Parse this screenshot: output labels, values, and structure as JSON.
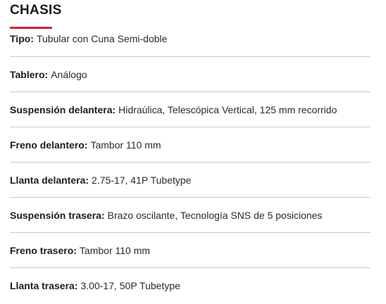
{
  "section": {
    "title": "CHASIS",
    "accent_color": "#d0242b"
  },
  "specs": [
    {
      "label": "Tipo",
      "sep": " :",
      "value": "Tubular con Cuna Semi-doble"
    },
    {
      "label": "Tablero",
      "sep": " :",
      "value": "Análogo"
    },
    {
      "label": "Suspensión delantera",
      "sep": " :",
      "value": "Hidraúlica, Telescópica Vertical, 125 mm recorrido"
    },
    {
      "label": "Freno delantero",
      "sep": " :",
      "value": "Tambor 110 mm"
    },
    {
      "label": "Llanta delantera",
      "sep": ":",
      "value": "2.75-17, 41P Tubetype"
    },
    {
      "label": "Suspensión trasera",
      "sep": " :",
      "value": "Brazo oscilante, Tecnología SNS de 5 posiciones"
    },
    {
      "label": "Freno trasero",
      "sep": ":",
      "value": "Tambor 110 mm"
    },
    {
      "label": "Llanta trasera",
      "sep": ":",
      "value": "3.00-17, 50P Tubetype"
    }
  ]
}
